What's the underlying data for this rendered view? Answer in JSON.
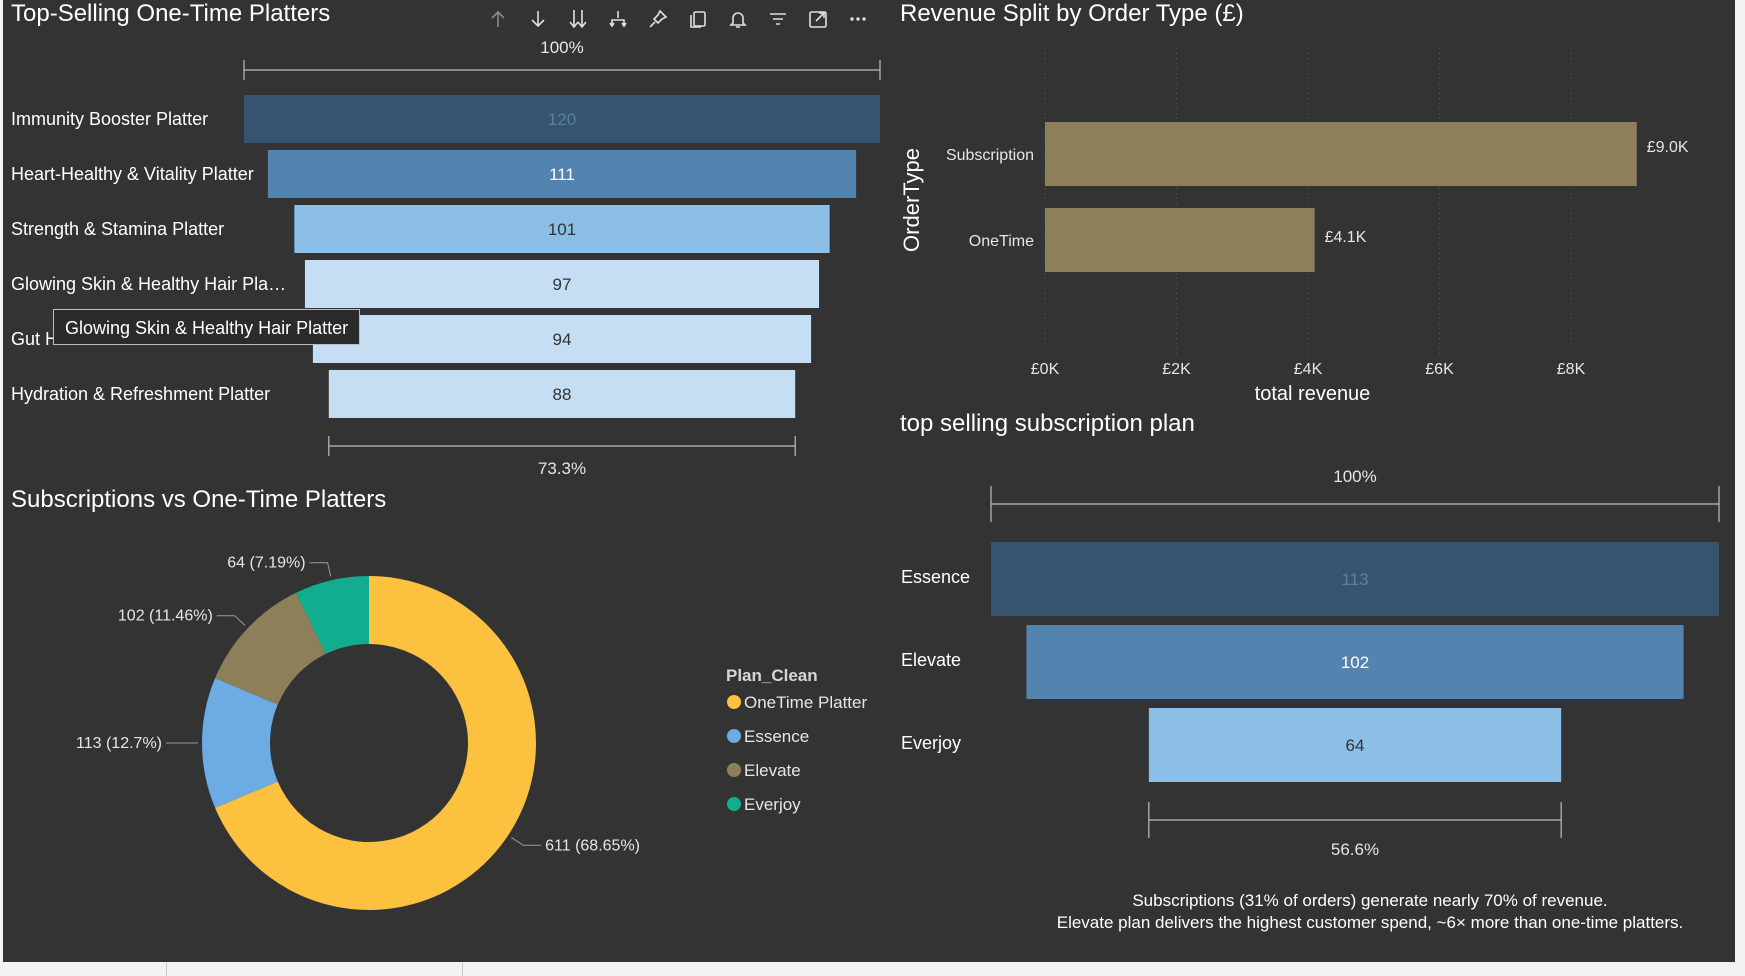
{
  "visuals": {
    "funnel1": {
      "title": "Top-Selling One-Time Platters"
    },
    "orderType": {
      "title": "Revenue Split by Order Type (£)"
    },
    "donut": {
      "title": "Subscriptions vs One-Time Platters"
    },
    "funnel2": {
      "title": "top selling subscription plan"
    }
  },
  "toolbar": {
    "icons": [
      "arrow-up-icon",
      "arrow-down-icon",
      "double-arrow-down-icon",
      "drill-hierarchy-icon",
      "pin-icon",
      "copy-icon",
      "bell-icon",
      "filter-icon",
      "focus-mode-icon",
      "more-options-icon"
    ]
  },
  "tooltip": {
    "text": "Glowing Skin & Healthy Hair Platter"
  },
  "insight": {
    "line1": "Subscriptions (31% of orders) generate nearly 70% of revenue.",
    "line2": "Elevate plan delivers the highest customer spend, ~6× more than one-time platters."
  },
  "colors": {
    "background": "#333333",
    "funnel_dark": "#365470",
    "funnel_mid": "#5383AF",
    "funnel_light": "#8CBFE6",
    "funnel_lightest": "#C5DEF3",
    "revenue_bar": "#8E7F5B",
    "onetime": "#FDC140",
    "essence": "#6CABE4",
    "elevate": "#8E7F5B",
    "everjoy": "#12AC8E"
  },
  "chart_data": [
    {
      "type": "bar",
      "subtype": "funnel",
      "title": "Top-Selling One-Time Platters",
      "categories": [
        "Immunity Booster Platter",
        "Heart-Healthy & Vitality Platter",
        "Strength & Stamina Platter",
        "Glowing Skin & Healthy Hair Pla…",
        "Gut H",
        "Hydration & Refreshment Platter"
      ],
      "values": [
        120,
        111,
        101,
        97,
        94,
        88
      ],
      "value_labels": [
        "120",
        "111",
        "101",
        "97",
        "94",
        "88"
      ],
      "top_label": "100%",
      "bottom_label": "73.3%"
    },
    {
      "type": "bar",
      "orientation": "horizontal",
      "title": "Revenue Split by Order Type (£)",
      "categories": [
        "Subscription",
        "OneTime"
      ],
      "values": [
        9000,
        4100
      ],
      "value_labels": [
        "£9.0K",
        "£4.1K"
      ],
      "xlabel": "total revenue",
      "ylabel": "OrderType",
      "xticks": [
        "£0K",
        "£2K",
        "£4K",
        "£6K",
        "£8K"
      ],
      "xtick_values": [
        0,
        2000,
        4000,
        6000,
        8000
      ],
      "xlim": [
        0,
        9000
      ],
      "grid": "vertical dotted"
    },
    {
      "type": "pie",
      "subtype": "donut",
      "title": "Subscriptions vs One-Time Platters",
      "legend_title": "Plan_Clean",
      "legend_position": "right",
      "categories": [
        "OneTime Platter",
        "Essence",
        "Elevate",
        "Everjoy"
      ],
      "values": [
        611,
        113,
        102,
        64
      ],
      "labels": [
        "611 (68.65%)",
        "113 (12.7%)",
        "102 (11.46%)",
        "64 (7.19%)"
      ]
    },
    {
      "type": "bar",
      "subtype": "funnel",
      "title": "top selling subscription plan",
      "categories": [
        "Essence",
        "Elevate",
        "Everjoy"
      ],
      "values": [
        113,
        102,
        64
      ],
      "value_labels": [
        "113",
        "102",
        "64"
      ],
      "top_label": "100%",
      "bottom_label": "56.6%"
    }
  ]
}
